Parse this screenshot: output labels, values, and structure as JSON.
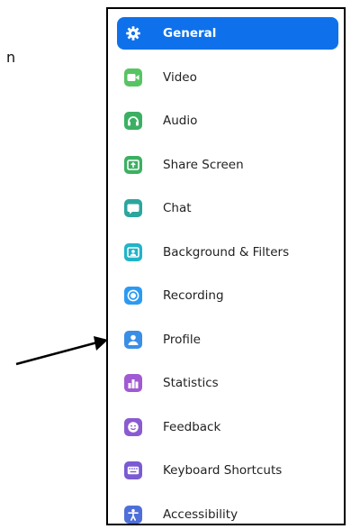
{
  "stray_text": "n",
  "sidebar": {
    "items": [
      {
        "label": "General",
        "icon": "gear-icon",
        "color": "#0e71eb",
        "active": true
      },
      {
        "label": "Video",
        "icon": "video-camera-icon",
        "color": "#57c463"
      },
      {
        "label": "Audio",
        "icon": "headphones-icon",
        "color": "#3cb062"
      },
      {
        "label": "Share Screen",
        "icon": "share-screen-icon",
        "color": "#3cb062"
      },
      {
        "label": "Chat",
        "icon": "chat-bubble-icon",
        "color": "#2ca59f"
      },
      {
        "label": "Background & Filters",
        "icon": "background-person-icon",
        "color": "#21b3c9"
      },
      {
        "label": "Recording",
        "icon": "recording-icon",
        "color": "#2b9af3"
      },
      {
        "label": "Profile",
        "icon": "profile-icon",
        "color": "#3a8ee6"
      },
      {
        "label": "Statistics",
        "icon": "statistics-bar-chart-icon",
        "color": "#a05ad2"
      },
      {
        "label": "Feedback",
        "icon": "feedback-smiley-icon",
        "color": "#8a5bd1"
      },
      {
        "label": "Keyboard Shortcuts",
        "icon": "keyboard-icon",
        "color": "#7a5bd1"
      },
      {
        "label": "Accessibility",
        "icon": "accessibility-person-icon",
        "color": "#4f6fd8"
      }
    ]
  }
}
